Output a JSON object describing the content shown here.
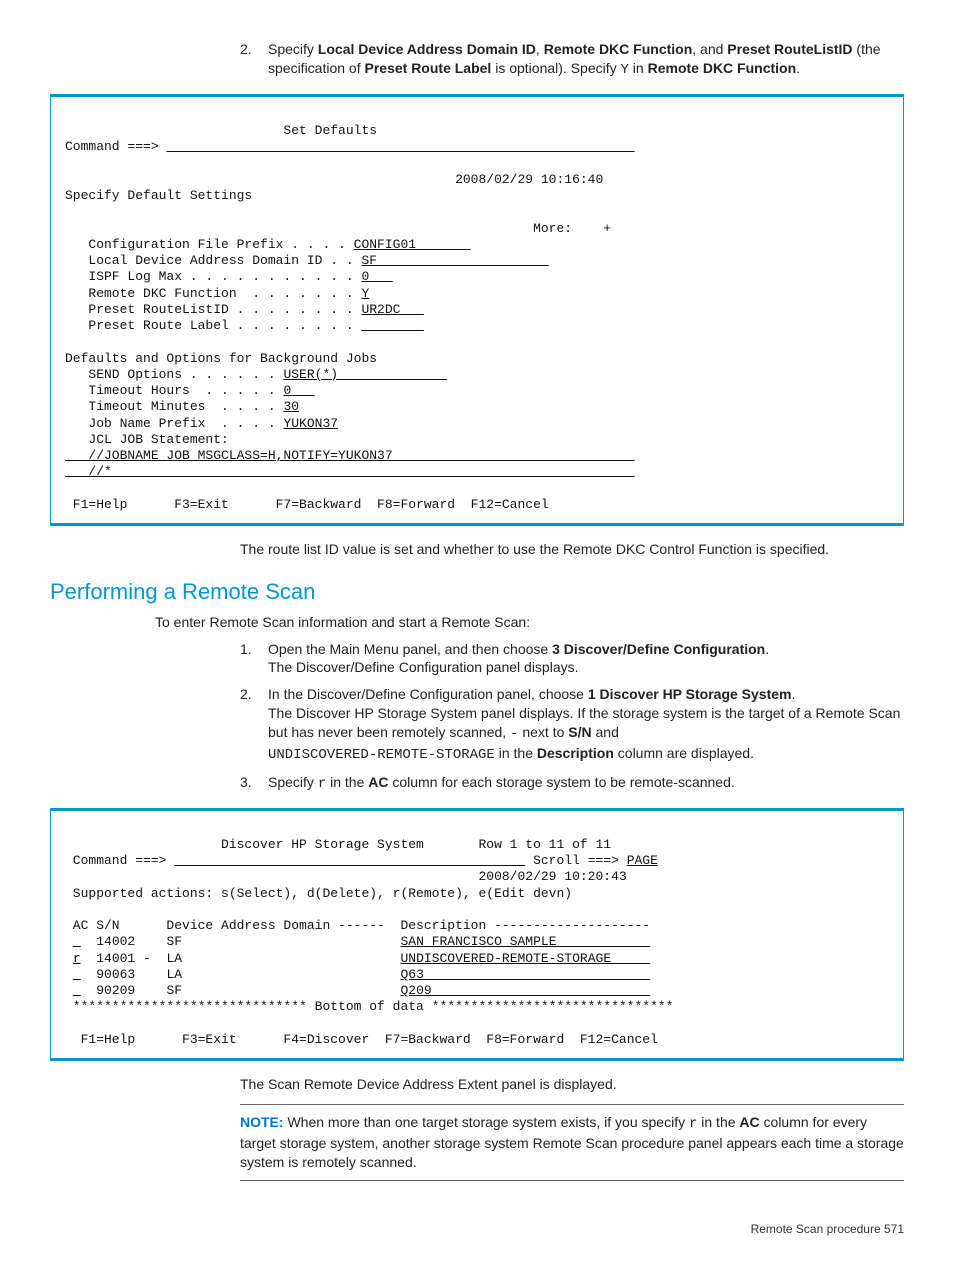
{
  "step2": {
    "num": "2.",
    "text_a": "Specify ",
    "b1": "Local Device Address Domain ID",
    "sep1": ", ",
    "b2": "Remote DKC Function",
    "sep2": ", and ",
    "b3": "Preset RouteListID",
    "text_b": " (the specification of ",
    "b4": "Preset Route Label",
    "text_c": " is optional). Specify ",
    "code1": "Y",
    "text_d": " in ",
    "b5": "Remote DKC Function",
    "text_e": "."
  },
  "panel1": {
    "title": "                            Set Defaults",
    "cmd_label": "Command ===> ",
    "datetime": "                                                  2008/02/29 10:16:40",
    "specify": "Specify Default Settings",
    "more": "                                                            More:    +",
    "l1a": "   Configuration File Prefix . . . . ",
    "l1b": "CONFIG01       ",
    "l2a": "   Local Device Address Domain ID . . ",
    "l2b": "SF                      ",
    "l3a": "   ISPF Log Max . . . . . . . . . . . ",
    "l3b": "0   ",
    "l4a": "   Remote DKC Function  . . . . . . . ",
    "l4b": "Y",
    "l5a": "   Preset RouteListID . . . . . . . . ",
    "l5b": "UR2DC   ",
    "l6a": "   Preset Route Label . . . . . . . . ",
    "l6b": "        ",
    "bg_hdr": "Defaults and Options for Background Jobs",
    "b1a": "   SEND Options . . . . . . ",
    "b1b": "USER(*)              ",
    "b2a": "   Timeout Hours  . . . . . ",
    "b2b": "0   ",
    "b3a": "   Timeout Minutes  . . . . ",
    "b3b": "30",
    "b4a": "   Job Name Prefix  . . . . ",
    "b4b": "YUKON37",
    "jcl_label": "   JCL JOB Statement:",
    "jcl1": "   //JOBNAME JOB MSGCLASS=H,NOTIFY=YUKON37                               ",
    "jcl2": "   //*                                                                   ",
    "fkeys": " F1=Help      F3=Exit      F7=Backward  F8=Forward  F12=Cancel"
  },
  "after_panel1": "The route list ID value is set and whether to use the Remote DKC Control Function is specified.",
  "section_title": "Performing a Remote Scan",
  "intro2": "To enter Remote Scan information and start a Remote Scan:",
  "rs1": {
    "num": "1.",
    "a": "Open the Main Menu panel, and then choose ",
    "b": "3 Discover/Define Configuration",
    "c": ".",
    "line2": "The Discover/Define Configuration panel displays."
  },
  "rs2": {
    "num": "2.",
    "a": "In the Discover/Define Configuration panel, choose ",
    "b": "1 Discover HP Storage System",
    "c": ".",
    "p2a": "The Discover HP Storage System panel displays. If the storage system is the target of a Remote Scan but has never been remotely scanned, ",
    "dash": "-",
    "p2b": " next to ",
    "sn": "S/N",
    "p2c": " and",
    "code": "UNDISCOVERED-REMOTE-STORAGE",
    "p2d": " in the ",
    "desc": "Description",
    "p2e": " column are displayed."
  },
  "rs3": {
    "num": "3.",
    "a": "Specify ",
    "r": "r",
    "b": " in the ",
    "ac": "AC",
    "c": " column for each storage system to be remote-scanned."
  },
  "panel2": {
    "title": "                    Discover HP Storage System       Row 1 to 11 of 11",
    "cmd_label": " Command ===> ",
    "cmd_blank": "                                             ",
    "scroll_lab": " Scroll ===> ",
    "scroll_val": "PAGE",
    "datetime": "                                                     2008/02/29 10:20:43",
    "actions": " Supported actions: s(Select), d(Delete), r(Remote), e(Edit devn)",
    "hdr": " AC S/N      Device Address Domain ------  Description --------------------",
    "r1a": " ",
    "r1b": "_",
    "r1c": "  14002    SF                            ",
    "r1d": "SAN FRANCISCO SAMPLE            ",
    "r2a": " ",
    "r2b": "r",
    "r2c": "  14001 -  LA                            ",
    "r2d": "UNDISCOVERED-REMOTE-STORAGE     ",
    "r3a": " ",
    "r3b": "_",
    "r3c": "  90063    LA                            ",
    "r3d": "Q63                             ",
    "r4a": " ",
    "r4b": "_",
    "r4c": "  90209    SF                            ",
    "r4d": "Q209                            ",
    "bottom": " ****************************** Bottom of data *******************************",
    "fkeys": "  F1=Help      F3=Exit      F4=Discover  F7=Backward  F8=Forward  F12=Cancel"
  },
  "after_panel2": "The Scan Remote Device Address Extent panel is displayed.",
  "note": {
    "label": "NOTE:",
    "a": "   When more than one target storage system exists, if you specify ",
    "r": "r",
    "b": " in the ",
    "ac": "AC",
    "c": " column for every target storage system, another storage system Remote Scan procedure panel appears each time a storage system is remotely scanned."
  },
  "footer": "Remote Scan procedure   571"
}
